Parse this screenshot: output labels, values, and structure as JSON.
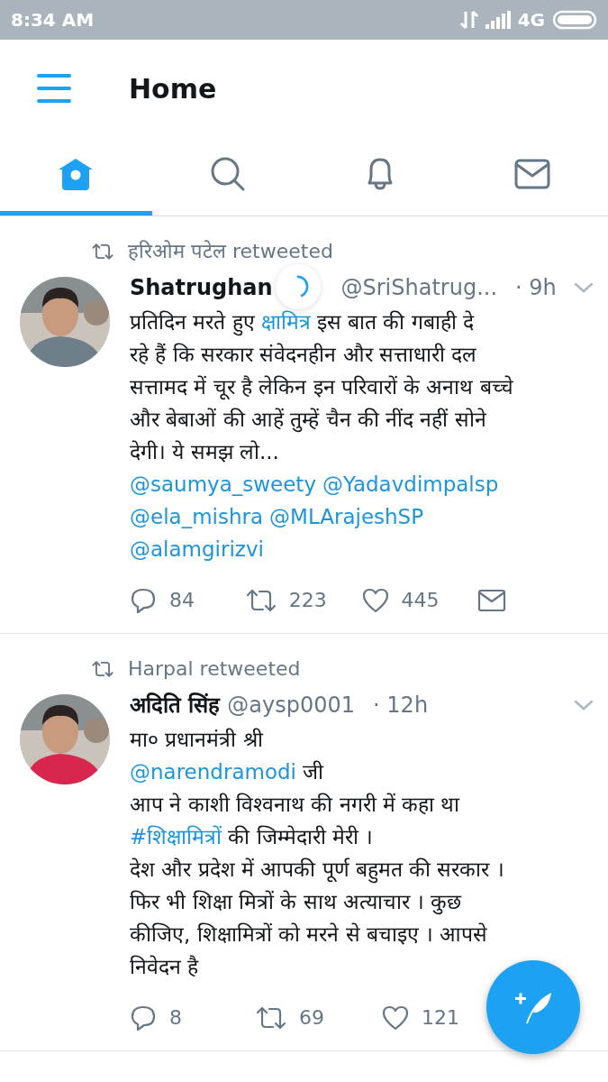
{
  "status_bar": {
    "time": "8:34 AM",
    "network": "4G"
  },
  "header": {
    "title": "Home"
  },
  "tabs": [
    {
      "kind": "home",
      "selected": true
    },
    {
      "kind": "search",
      "selected": false
    },
    {
      "kind": "notifications",
      "selected": false
    },
    {
      "kind": "messages",
      "selected": false
    }
  ],
  "loading": true,
  "tweets": [
    {
      "retweeted_by": "हरिओम पटेल retweeted",
      "name": "Shatrughan",
      "handle": "@SriShatrug...",
      "time": "· 9h",
      "avatar": {
        "kind": "picture"
      },
      "lines": [
        [
          {
            "kind": "text",
            "text": "प्रतिदिन मरते हुए"
          },
          {
            "kind": "link",
            "text": "क्षामित्र"
          },
          {
            "kind": "text",
            "text": "इस बात की गबाही दे"
          }
        ],
        [
          {
            "kind": "text",
            "text": "रहे हैं कि सरकार संवेदनहीन और सत्ताधारी दल"
          }
        ],
        [
          {
            "kind": "text",
            "text": "सत्तामद में चूर है लेकिन इन परिवारों के अनाथ बच्चे"
          }
        ],
        [
          {
            "kind": "text",
            "text": "और बेबाओं की आहें तुम्हें चैन की नींद नहीं सोने"
          }
        ],
        [
          {
            "kind": "text",
            "text": "देगी। ये समझ लो..."
          }
        ],
        [
          {
            "kind": "link",
            "text": "@saumya_sweety"
          },
          {
            "kind": "link",
            "text": "@Yadavdimpalsp"
          }
        ],
        [
          {
            "kind": "link",
            "text": "@ela_mishra"
          },
          {
            "kind": "link",
            "text": "@MLArajeshSP"
          }
        ],
        [
          {
            "kind": "link",
            "text": "@alamgirizvi"
          }
        ]
      ],
      "actions": [
        {
          "kind": "reply",
          "count": "84"
        },
        {
          "kind": "retweet",
          "count": "223"
        },
        {
          "kind": "like",
          "count": "445"
        },
        {
          "kind": "message"
        }
      ]
    },
    {
      "retweeted_by": "Harpal retweeted",
      "name": "अदिति सिंह",
      "handle": "@aysp0001",
      "time": "· 12h",
      "avatar": {
        "kind": "picture"
      },
      "lines": [
        [
          {
            "kind": "text",
            "text": "मा० प्रधानमंत्री श्री"
          }
        ],
        [
          {
            "kind": "link",
            "text": "@narendramodi"
          },
          {
            "kind": "text",
            "text": "जी"
          }
        ],
        [
          {
            "kind": "text",
            "text": "आप ने काशी विश्वनाथ की नगरी में कहा था"
          }
        ],
        [
          {
            "kind": "link",
            "text": "#शिक्षामित्रों"
          },
          {
            "kind": "text",
            "text": "की जिम्मेदारी मेरी ।"
          }
        ],
        [
          {
            "kind": "text",
            "text": "देश और प्रदेश में आपकी पूर्ण बहुमत की सरकार ।"
          }
        ],
        [
          {
            "kind": "text",
            "text": "फिर भी शिक्षा मित्रों के साथ अत्याचार । कुछ"
          }
        ],
        [
          {
            "kind": "text",
            "text": "कीजिए,  शिक्षामित्रों को मरने से बचाइए । आपसे"
          }
        ],
        [
          {
            "kind": "text",
            "text": "निवेदन है"
          }
        ]
      ],
      "actions": [
        {
          "kind": "reply",
          "count": "8"
        },
        {
          "kind": "retweet",
          "count": "69"
        },
        {
          "kind": "like",
          "count": "121"
        }
      ]
    }
  ]
}
